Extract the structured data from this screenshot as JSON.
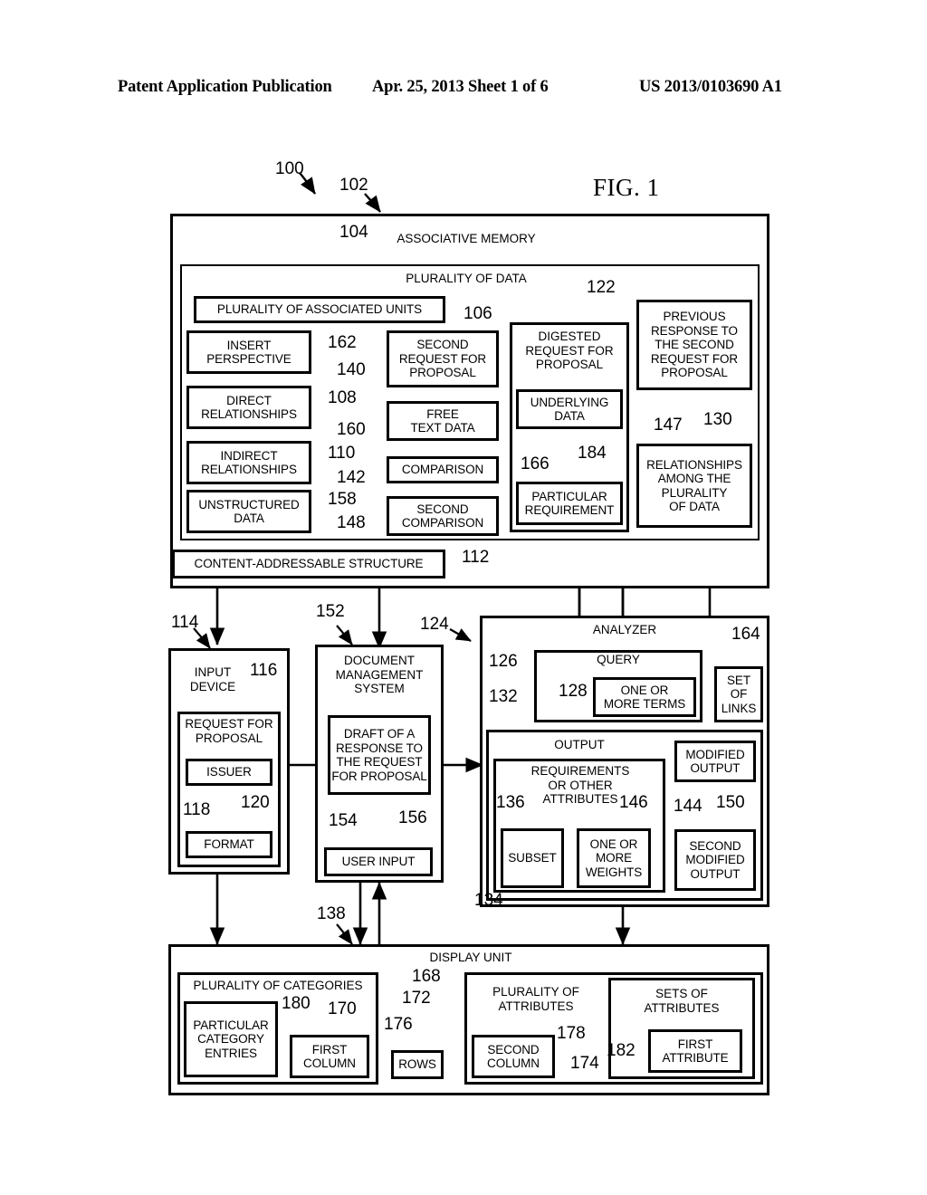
{
  "header": {
    "left": "Patent Application Publication",
    "middle": "Apr. 25, 2013  Sheet 1 of 6",
    "right": "US 2013/0103690 A1"
  },
  "figure": {
    "label": "FIG. 1"
  },
  "diagram": {
    "system_ref": "100",
    "associative_memory": {
      "title": "ASSOCIATIVE MEMORY",
      "ref": "102",
      "plurality_of_data": {
        "title": "PLURALITY OF DATA",
        "ref": "104",
        "plurality_of_associated_units": {
          "label": "PLURALITY OF ASSOCIATED UNITS",
          "ref": "106"
        },
        "left_column": [
          {
            "label": "INSERT\nPERSPECTIVE",
            "ref": "162"
          },
          {
            "label": "DIRECT\nRELATIONSHIPS",
            "ref": "108"
          },
          {
            "label": "INDIRECT\nRELATIONSHIPS",
            "ref": "110"
          },
          {
            "label": "UNSTRUCTURED\nDATA",
            "ref": "158"
          }
        ],
        "middle_column": [
          {
            "label": "SECOND\nREQUEST FOR\nPROPOSAL",
            "ref": "140"
          },
          {
            "label": "FREE\nTEXT DATA",
            "ref": "160"
          },
          {
            "label": "COMPARISON",
            "ref": "142"
          },
          {
            "label": "SECOND\nCOMPARISON",
            "ref": "148"
          }
        ],
        "digested_request": {
          "title": "DIGESTED\nREQUEST FOR\nPROPOSAL",
          "ref": "122",
          "children": [
            {
              "label": "UNDERLYING\nDATA",
              "ref": "166"
            },
            {
              "label": "PARTICULAR\nREQUIREMENT",
              "ref": "184"
            }
          ]
        },
        "right_column": [
          {
            "label": "PREVIOUS\nRESPONSE TO\nTHE SECOND\nREQUEST FOR\nPROPOSAL",
            "ref": "147"
          },
          {
            "label": "RELATIONSHIPS\nAMONG THE\nPLURALITY\nOF DATA",
            "ref": "130"
          }
        ]
      },
      "content_addressable_structure": {
        "label": "CONTENT-ADDRESSABLE STRUCTURE",
        "ref": "112"
      }
    },
    "input_device": {
      "title": "INPUT\nDEVICE",
      "ref": "114",
      "request_for_proposal": {
        "label": "REQUEST FOR\nPROPOSAL",
        "ref": "116",
        "children": [
          {
            "label": "ISSUER",
            "ref": "118"
          },
          {
            "label": "FORMAT",
            "ref": "120"
          }
        ]
      }
    },
    "document_management_system": {
      "title": "DOCUMENT\nMANAGEMENT\nSYSTEM",
      "ref": "152",
      "draft": {
        "label": "DRAFT OF A\nRESPONSE TO\nTHE REQUEST\nFOR PROPOSAL",
        "ref": "154"
      },
      "user_input": {
        "label": "USER INPUT",
        "ref": "156"
      }
    },
    "analyzer": {
      "title": "ANALYZER",
      "ref": "124",
      "query": {
        "label": "QUERY",
        "ref": "126",
        "terms": {
          "label": "ONE OR\nMORE TERMS",
          "ref": "128"
        }
      },
      "set_of_links": {
        "label": "SET\nOF\nLINKS",
        "ref": "164"
      },
      "output": {
        "label": "OUTPUT",
        "ref": "132",
        "requirements": {
          "label": "REQUIREMENTS\nOR OTHER\nATTRIBUTES",
          "ref": "134",
          "children": [
            {
              "label": "SUBSET",
              "ref": "136"
            },
            {
              "label": "ONE OR\nMORE\nWEIGHTS",
              "ref": "146"
            }
          ]
        },
        "modified_output": {
          "label": "MODIFIED\nOUTPUT",
          "ref": "144"
        },
        "second_modified_output": {
          "label": "SECOND\nMODIFIED\nOUTPUT",
          "ref": "150"
        }
      }
    },
    "display_unit": {
      "title": "DISPLAY UNIT",
      "ref": "138",
      "plurality_of_categories": {
        "label": "PLURALITY OF CATEGORIES",
        "ref": "168",
        "particular_category_entries": {
          "label": "PARTICULAR\nCATEGORY\nENTRIES",
          "ref": "180"
        },
        "first_column": {
          "label": "FIRST\nCOLUMN",
          "ref": "170"
        }
      },
      "rows": {
        "label": "ROWS",
        "ref": "176"
      },
      "plurality_of_attributes": {
        "label": "PLURALITY OF\nATTRIBUTES",
        "ref": "172",
        "second_column": {
          "label": "SECOND\nCOLUMN",
          "ref": "174"
        },
        "sets_of_attributes": {
          "label": "SETS OF\nATTRIBUTES",
          "ref": "178",
          "first_attribute": {
            "label": "FIRST\nATTRIBUTE",
            "ref": "182"
          }
        }
      }
    }
  }
}
